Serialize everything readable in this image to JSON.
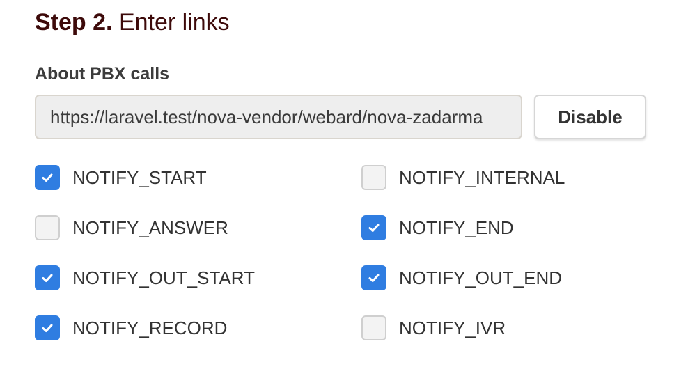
{
  "step": {
    "number": "Step 2.",
    "title": "Enter links"
  },
  "section": {
    "label": "About PBX calls"
  },
  "url_field": {
    "value": "https://laravel.test/nova-vendor/webard/nova-zadarma"
  },
  "disable_button": {
    "label": "Disable"
  },
  "options": [
    {
      "label": "NOTIFY_START",
      "checked": true
    },
    {
      "label": "NOTIFY_INTERNAL",
      "checked": false
    },
    {
      "label": "NOTIFY_ANSWER",
      "checked": false
    },
    {
      "label": "NOTIFY_END",
      "checked": true
    },
    {
      "label": "NOTIFY_OUT_START",
      "checked": true
    },
    {
      "label": "NOTIFY_OUT_END",
      "checked": true
    },
    {
      "label": "NOTIFY_RECORD",
      "checked": true
    },
    {
      "label": "NOTIFY_IVR",
      "checked": false
    }
  ],
  "colors": {
    "checkbox_checked": "#2f7de1",
    "title": "#3d0a0a"
  },
  "icons": {
    "checked": "checkmark-icon"
  }
}
